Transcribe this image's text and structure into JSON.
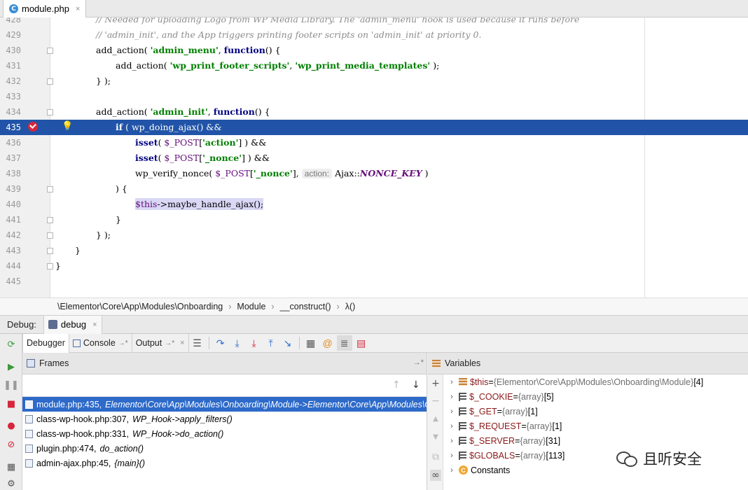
{
  "editor_tab": {
    "icon_letter": "C",
    "filename": "module.php",
    "close": "×"
  },
  "code": {
    "line_428": {
      "num": "428",
      "text": "// Needed for uploading Logo from WP Media Library. The 'admin_menu' hook is used because it runs before"
    },
    "line_429": {
      "num": "429",
      "text": "// 'admin_init', and the App triggers printing footer scripts on 'admin_init' at priority 0."
    },
    "line_430": {
      "num": "430",
      "p1": "add_action( ",
      "s1": "'admin_menu'",
      "p2": ", ",
      "k1": "function",
      "p3": "() {"
    },
    "line_431": {
      "num": "431",
      "p1": "add_action( ",
      "s1": "'wp_print_footer_scripts'",
      "p2": ", ",
      "s2": "'wp_print_media_templates'",
      "p3": " );"
    },
    "line_432": {
      "num": "432",
      "text": "} );"
    },
    "line_433": {
      "num": "433"
    },
    "line_434": {
      "num": "434",
      "p1": "add_action( ",
      "s1": "'admin_init'",
      "p2": ", ",
      "k1": "function",
      "p3": "() {"
    },
    "line_435": {
      "num": "435",
      "k1": "if",
      "p1": " ( wp_doing_ajax() &&"
    },
    "line_436": {
      "num": "436",
      "k1": "isset",
      "p1": "( ",
      "v1": "$_POST",
      "p2": "[",
      "s1": "'action'",
      "p3": "] ) &&"
    },
    "line_437": {
      "num": "437",
      "k1": "isset",
      "p1": "( ",
      "v1": "$_POST",
      "p2": "[",
      "s1": "'_nonce'",
      "p3": "] ) &&"
    },
    "line_438": {
      "num": "438",
      "p1": "wp_verify_nonce( ",
      "v1": "$_POST",
      "p2": "[",
      "s1": "'_nonce'",
      "p3": "],",
      "hint": "action:",
      "p4": "Ajax::",
      "c1": "NONCE_KEY",
      "p5": " )"
    },
    "line_439": {
      "num": "439",
      "text": ") {"
    },
    "line_440": {
      "num": "440",
      "v1": "$this",
      "p1": "->maybe_handle_ajax();"
    },
    "line_441": {
      "num": "441",
      "text": "}"
    },
    "line_442": {
      "num": "442",
      "text": "} );"
    },
    "line_443": {
      "num": "443",
      "text": "}"
    },
    "line_444": {
      "num": "444",
      "text": "}"
    },
    "line_445": {
      "num": "445"
    }
  },
  "breadcrumb": [
    "\\Elementor\\Core\\App\\Modules\\Onboarding",
    "Module",
    "__construct()",
    "λ()"
  ],
  "breadcrumb_sep": "›",
  "debug_bar": {
    "label": "Debug:",
    "tab": "debug",
    "close": "×"
  },
  "debugger_tabs": {
    "debugger": "Debugger",
    "console": "Console",
    "output": "Output",
    "pin": "→*",
    "close": "×"
  },
  "frames": {
    "title": "Frames",
    "pin": "→*",
    "items": [
      {
        "loc": "module.php:435,",
        "fn": "Elementor\\Core\\App\\Modules\\Onboarding\\Module->Elementor\\Core\\App\\Modules\\Onboarding\\{closure}()"
      },
      {
        "loc": "class-wp-hook.php:307,",
        "fn": "WP_Hook->apply_filters()"
      },
      {
        "loc": "class-wp-hook.php:331,",
        "fn": "WP_Hook->do_action()"
      },
      {
        "loc": "plugin.php:474,",
        "fn": "do_action()"
      },
      {
        "loc": "admin-ajax.php:45,",
        "fn": "{main}()"
      }
    ]
  },
  "variables": {
    "title": "Variables",
    "items": [
      {
        "name": "$this",
        "eq": " = ",
        "type": "{Elementor\\Core\\App\\Modules\\Onboarding\\Module}",
        "count": " [4]"
      },
      {
        "name": "$_COOKIE",
        "eq": " = ",
        "type": "{array}",
        "count": " [5]"
      },
      {
        "name": "$_GET",
        "eq": " = ",
        "type": "{array}",
        "count": " [1]"
      },
      {
        "name": "$_REQUEST",
        "eq": " = ",
        "type": "{array}",
        "count": " [1]"
      },
      {
        "name": "$_SERVER",
        "eq": " = ",
        "type": "{array}",
        "count": " [31]"
      },
      {
        "name": "$GLOBALS",
        "eq": " = ",
        "type": "{array}",
        "count": " [113]"
      },
      {
        "name": "Constants"
      }
    ]
  },
  "watermark": {
    "text": "且听安全"
  },
  "colors": {
    "execution_line": "#2154a8",
    "selected_frame": "#2d6ac9",
    "breakpoint": "#d6263b"
  }
}
